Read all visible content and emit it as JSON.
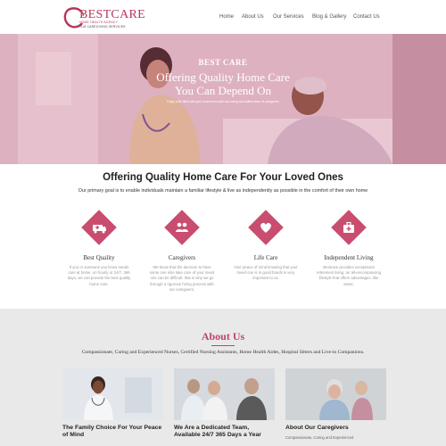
{
  "header": {
    "logo_name": "BESTCARE",
    "logo_tagline1": "HOME HEALTH AGENCY",
    "logo_tagline2": "TLM CAREGIVING SERVICES",
    "nav": [
      "Home",
      "About Us",
      "Our Services",
      "Blog & Gallery",
      "Contact Us"
    ]
  },
  "hero": {
    "brand": "BEST CARE",
    "headline1": "Offering Quality Home Care",
    "headline2": "You Can Depend On",
    "small": "Enjoy a life filled with your loved ones with our caring and skilled team of caregivers"
  },
  "quality": {
    "title": "Offering Quality Home Care For Your Loved Ones",
    "intro": "Our primary goal is to enable individuals maintain a familiar lifestyle & live as independently as possible in the comfort of their own home",
    "features": [
      {
        "icon": "ambulance-icon",
        "title": "Best Quality",
        "desc": "If you or someone you know needs care at home, on hourly or 24/7, 365 days, we can provide the best quality home care."
      },
      {
        "icon": "caregiver-icon",
        "title": "Caregivers",
        "desc": "We know that the decision to have some one else take care of your loved one can be difficult, that is why we go through a rigorous hiring process with our caregivers."
      },
      {
        "icon": "heart-icon",
        "title": "Life Care",
        "desc": "Your peace of mind knowing that your loved one is in good hands is very important to us."
      },
      {
        "icon": "medical-kit-icon",
        "title": "Independent Living",
        "desc": "Bestcare provides exceptional retirement living, an all-encompassing lifestyle that offers advantages, like asset."
      }
    ]
  },
  "about": {
    "title": "About Us",
    "desc": "Compassionate, Caring and Experienced Nurses, Certified Nursing Assistants, Home Health Aides, Hospital Sitters and Live-in Companions.",
    "cards": [
      {
        "title": "The Family Choice For Your Peace of Mind",
        "sub": ""
      },
      {
        "title": "We Are a Dedicated Team, Available 24/7 365 Days a Year",
        "sub": ""
      },
      {
        "title": "About Our Caregivers",
        "sub": "Compassionate, Caring and Experienced"
      }
    ]
  },
  "colors": {
    "accent": "#c84d6f",
    "about_bg": "#e9e9e9"
  }
}
